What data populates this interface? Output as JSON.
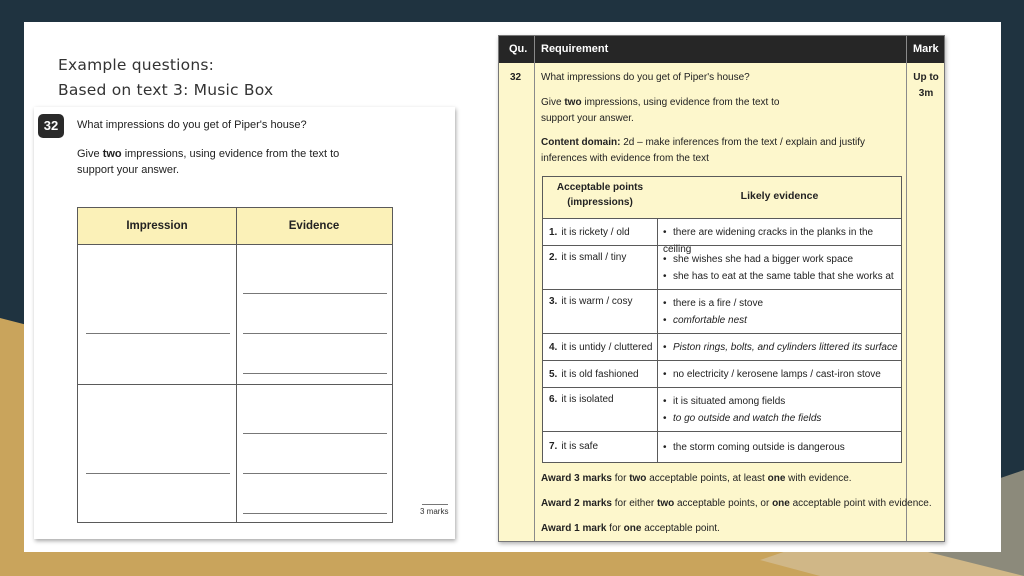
{
  "slide": {
    "heading_line1": "Example questions:",
    "heading_line2": "Based on text 3: Music Box"
  },
  "question_sheet": {
    "number": "32",
    "prompt": "What impressions do you get of Piper's house?",
    "instruction_pre": "Give ",
    "instruction_bold": "two",
    "instruction_post": " impressions, using evidence from the text to support your answer.",
    "col_impression": "Impression",
    "col_evidence": "Evidence",
    "marks": "3 marks"
  },
  "mark_scheme": {
    "header_qu": "Qu.",
    "header_requirement": "Requirement",
    "header_mark": "Mark",
    "question_number": "32",
    "marks_available": "Up to 3m",
    "prompt": "What impressions do you get of Piper's house?",
    "instruction_pre": "Give ",
    "instruction_bold": "two",
    "instruction_post": " impressions, using evidence from the text to support your answer.",
    "domain_label": "Content domain:",
    "domain_text": " 2d – make inferences from the text / explain and justify inferences with evidence from the text",
    "table_head_points": "Acceptable points (impressions)",
    "table_head_evidence": "Likely evidence",
    "rows": [
      {
        "num": "1.",
        "point": "it is rickety / old",
        "evidence": [
          {
            "text": "there are widening cracks in the planks in the ceiling",
            "italic": false
          }
        ]
      },
      {
        "num": "2.",
        "point": "it is small / tiny",
        "evidence": [
          {
            "text": "she wishes she had a bigger work space",
            "italic": false
          },
          {
            "text": "she has to eat at the same table that she works at",
            "italic": false
          }
        ]
      },
      {
        "num": "3.",
        "point": "it is warm / cosy",
        "evidence": [
          {
            "text": "there is a fire / stove",
            "italic": false
          },
          {
            "text": "comfortable nest",
            "italic": true
          }
        ]
      },
      {
        "num": "4.",
        "point": "it is untidy / cluttered",
        "evidence": [
          {
            "text": "Piston rings, bolts, and cylinders littered its surface",
            "italic": true
          }
        ]
      },
      {
        "num": "5.",
        "point": "it is old fashioned",
        "evidence": [
          {
            "text": "no electricity / kerosene lamps / cast-iron stove",
            "italic": false
          }
        ]
      },
      {
        "num": "6.",
        "point": "it is isolated",
        "evidence": [
          {
            "text": "it is situated among fields",
            "italic": false
          },
          {
            "text": "to go outside and watch the fields",
            "italic": true
          }
        ]
      },
      {
        "num": "7.",
        "point": "it is safe",
        "evidence": [
          {
            "text": "the storm coming outside is dangerous",
            "italic": false
          }
        ]
      }
    ],
    "award3_bold": "Award 3 marks",
    "award3_mid1": " for ",
    "award3_bold2": "two",
    "award3_mid2": " acceptable points, at least ",
    "award3_bold3": "one",
    "award3_end": " with evidence.",
    "award2_bold": "Award 2 marks",
    "award2_mid1": " for either ",
    "award2_bold2": "two",
    "award2_mid2": " acceptable points, or ",
    "award2_bold3": "one",
    "award2_end": " acceptable point with evidence.",
    "award1_bold": "Award 1 mark",
    "award1_mid1": " for ",
    "award1_bold2": "one",
    "award1_end": " acceptable point."
  },
  "colors": {
    "background_dark": "#1f3340",
    "background_gold": "#c9a45c",
    "table_header_yellow": "#fbf1b8",
    "mark_scheme_cream": "#fdf7cc"
  }
}
